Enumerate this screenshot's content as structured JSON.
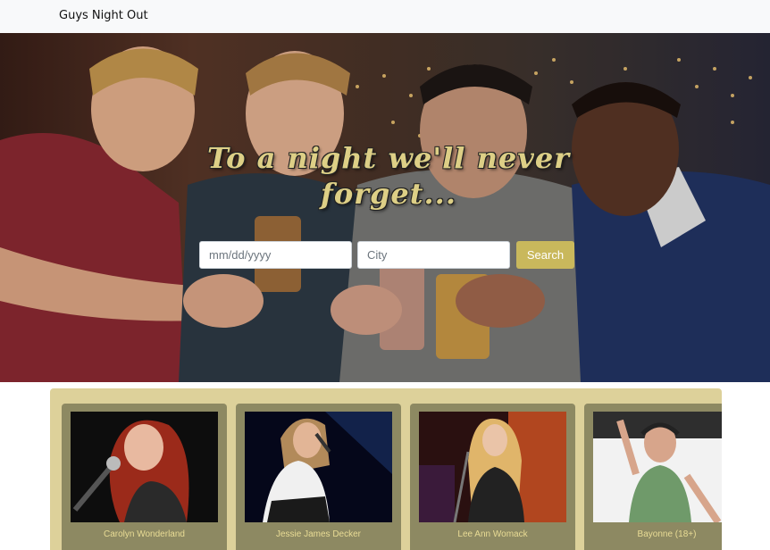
{
  "navbar": {
    "brand": "Guys Night Out"
  },
  "hero": {
    "tagline": "To a night we'll never forget...",
    "date_placeholder": "mm/dd/yyyy",
    "city_placeholder": "City",
    "search_label": "Search"
  },
  "events": [
    {
      "name": "Carolyn Wonderland"
    },
    {
      "name": "Jessie James Decker"
    },
    {
      "name": "Lee Ann Womack"
    },
    {
      "name": "Bayonne (18+)"
    }
  ],
  "colors": {
    "accent": "#c9b85c",
    "card": "#8d8962",
    "carousel_bg": "#ddd19a",
    "tagline": "#ddcf86"
  }
}
